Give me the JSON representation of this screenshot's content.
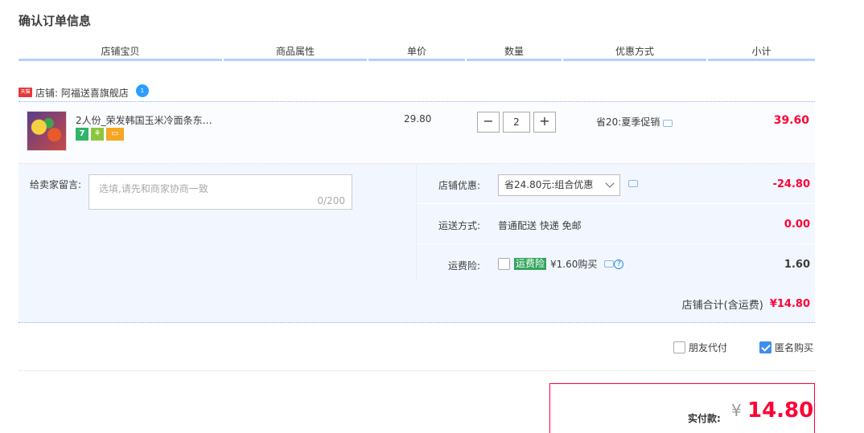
{
  "page": {
    "title": "确认订单信息"
  },
  "columns": [
    "店铺宝贝",
    "商品属性",
    "单价",
    "数量",
    "优惠方式",
    "小计"
  ],
  "shop": {
    "badge": "天猫",
    "label": "店铺: 阿福送喜旗舰店",
    "chat_badge": "1"
  },
  "item": {
    "name": "2人份_荣发韩国玉米冷面条东…",
    "price": "29.80",
    "quantity": "2",
    "minus": "−",
    "plus": "+",
    "promo": "省20:夏季促销",
    "subtotal": "39.60",
    "icon_seven": "7",
    "icon_gift": "⚘",
    "icon_card": "▭"
  },
  "memo": {
    "label": "给卖家留言:",
    "placeholder": "选填,请先和商家协商一致",
    "count": "0/200"
  },
  "shop_discount": {
    "label": "店铺优惠:",
    "selected": "省24.80元:组合优惠",
    "amount": "-24.80"
  },
  "shipping": {
    "label": "运送方式:",
    "value": "普通配送 快递 免邮",
    "amount": "0.00"
  },
  "insurance": {
    "label": "运费险:",
    "tag": "运费险",
    "price_text": "¥1.60购买",
    "help": "?",
    "amount": "1.60"
  },
  "shop_total": {
    "label": "店铺合计(含运费)",
    "amount": "¥14.80"
  },
  "options": {
    "friend_pay": "朋友代付",
    "anonymous": "匿名购买"
  },
  "payment": {
    "label": "实付款:",
    "currency": "¥",
    "amount": "14.80"
  },
  "colors": {
    "accent_red": "#ff0036",
    "header_line": "#b2d1ff",
    "panel_bg": "#f2f7ff",
    "checkbox_blue": "#3d8ef1"
  }
}
